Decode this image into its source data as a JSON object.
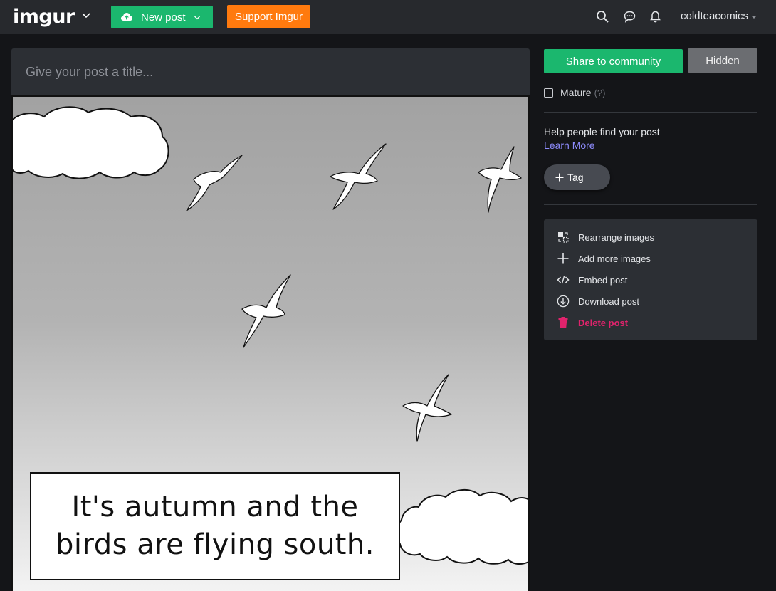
{
  "nav": {
    "logo_text": "imgur",
    "new_post_label": "New post",
    "support_label": "Support Imgur",
    "username": "coldteacomics"
  },
  "post": {
    "title_placeholder": "Give your post a title...",
    "caption": "It's autumn and the\nbirds are flying south."
  },
  "sidebar": {
    "share_label": "Share to community",
    "hidden_label": "Hidden",
    "mature_label": "Mature",
    "mature_help": "(?)",
    "help_text": "Help people find your post",
    "learn_more": "Learn More",
    "tag_label": "Tag",
    "actions": [
      {
        "label": "Rearrange images",
        "icon": "rearrange-icon"
      },
      {
        "label": "Add more images",
        "icon": "plus-icon"
      },
      {
        "label": "Embed post",
        "icon": "code-icon"
      },
      {
        "label": "Download post",
        "icon": "download-icon"
      },
      {
        "label": "Delete post",
        "icon": "trash-icon"
      }
    ]
  },
  "colors": {
    "background": "#141518",
    "nav_bg": "#27292d",
    "panel_bg": "#2c2f34",
    "green": "#1bb76e",
    "orange": "#ff7a0e",
    "link": "#8f8dff",
    "delete": "#e0236c"
  }
}
